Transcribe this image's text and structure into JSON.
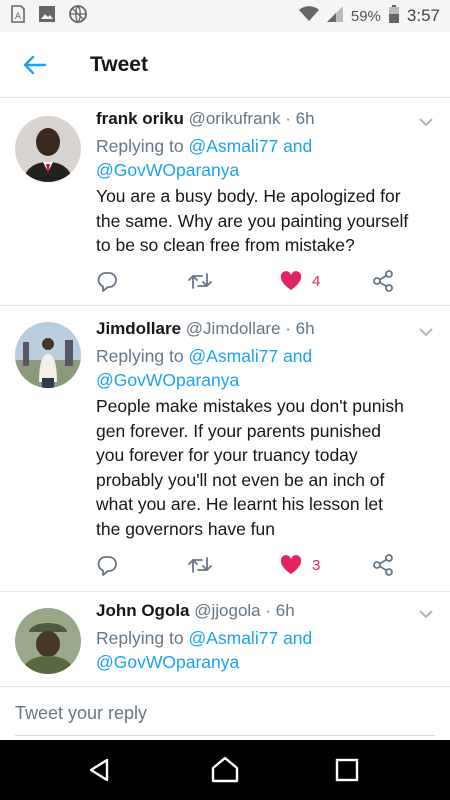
{
  "status_bar": {
    "battery": "59%",
    "time": "3:57"
  },
  "header": {
    "title": "Tweet"
  },
  "tweets": [
    {
      "name": "frank oriku",
      "handle": "@orikufrank",
      "time": "· 6h",
      "replying_prefix": "Replying to",
      "mention_1": "@Asmali77",
      "mention_join": "and",
      "mention_2": "@GovWOparanya",
      "text": "You are a busy body. He apologized for the same. Why are you painting yourself to be so clean free from mistake?",
      "likes": "4"
    },
    {
      "name": "Jimdollare",
      "handle": "@Jimdollare",
      "time": "· 6h",
      "replying_prefix": "Replying to",
      "mention_1": "@Asmali77",
      "mention_join": "and",
      "mention_2": "@GovWOparanya",
      "text": "People make mistakes you don't punish gen forever. If your parents punished you forever for your truancy today probably you'll not even be an inch of what you are. He learnt his lesson let the governors have fun",
      "likes": "3"
    },
    {
      "name": "John Ogola",
      "handle": "@jjogola",
      "time": "· 6h",
      "replying_prefix": "Replying to",
      "mention_1": "@Asmali77",
      "mention_join": "and",
      "mention_2": "@GovWOparanya"
    }
  ],
  "composer": {
    "placeholder": "Tweet your reply"
  },
  "colors": {
    "accent": "#1da1f2",
    "like": "#e0245e",
    "secondary_text": "#657786",
    "primary_text": "#14171a"
  }
}
